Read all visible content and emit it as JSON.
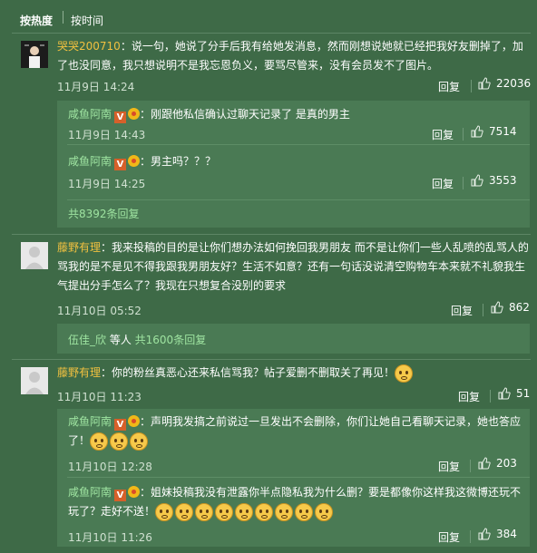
{
  "sort": {
    "hot": "按热度",
    "time": "按时间"
  },
  "comments": [
    {
      "user": "哭哭200710",
      "text": "：说一句，她说了分手后我有给她发消息，然而刚想说她就已经把我好友删掉了，加了也没同意，我只想说明不是我忘恩负义，要骂尽管来，没有会员发不了图片。",
      "time": "11月9日 14:24",
      "reply": "回复",
      "likes": "22036",
      "subs": [
        {
          "user": "咸鱼阿南",
          "text": "：刚跟他私信确认过聊天记录了 是真的男主",
          "time": "11月9日 14:43",
          "reply": "回复",
          "likes": "7514"
        },
        {
          "user": "咸鱼阿南",
          "text": "：男主吗？？？",
          "time": "11月9日 14:25",
          "reply": "回复",
          "likes": "3553"
        }
      ],
      "more": "共8392条回复"
    },
    {
      "user": "藤野有理",
      "text": "：我来投稿的目的是让你们想办法如何挽回我男朋友 而不是让你们一些人乱喷的乱骂人的骂我的是不是见不得我跟我男朋友好？生活不如意？还有一句话没说清空购物车本来就不礼貌我生气提出分手怎么了？我现在只想复合没别的要求",
      "time": "11月10日 05:52",
      "reply": "回复",
      "likes": "862",
      "footer": {
        "user": "伍佳_欣",
        "mid": " 等人 ",
        "count": "共1600条回复"
      }
    },
    {
      "user": "藤野有理",
      "text": "：你的粉丝真恶心还来私信骂我？帖子爱删不删取关了再见！",
      "time": "11月10日 11:23",
      "reply": "回复",
      "likes": "51",
      "subs": [
        {
          "user": "咸鱼阿南",
          "text": "：声明我发搞之前说过一旦发出不会删除，你们让她自己看聊天记录，她也答应了！",
          "time": "11月10日 12:28",
          "reply": "回复",
          "likes": "203"
        },
        {
          "user": "咸鱼阿南",
          "text": "：姐妹投稿我没有泄露你半点隐私我为什么删？要是都像你这样我这微博还玩不玩了？走好不送！",
          "time": "11月10日 11:26",
          "reply": "回复",
          "likes": "384"
        }
      ]
    }
  ],
  "colors": {
    "background": "#3e6a47",
    "username": "#f0c040",
    "link": "#9ee3a0"
  }
}
